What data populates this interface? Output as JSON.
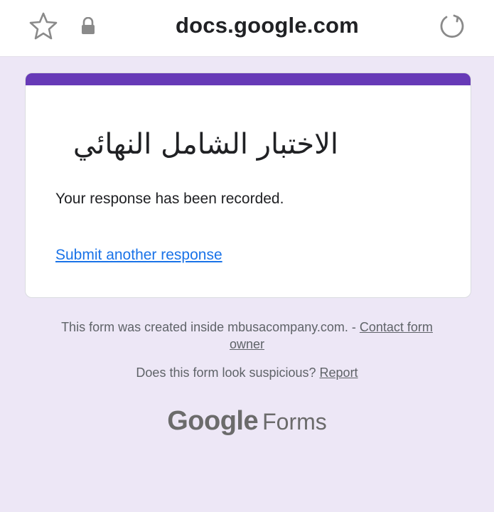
{
  "browser": {
    "url": "docs.google.com",
    "icons": {
      "bookmark": "star-outline-icon",
      "secure": "lock-icon",
      "reload": "reload-icon"
    }
  },
  "form": {
    "title": "الاختبار الشامل النهائي",
    "message": "Your response has been recorded.",
    "submit_another": "Submit another response",
    "accent_color": "#673ab7"
  },
  "footer": {
    "created_prefix": "This form was created inside mbusacompany.com. - ",
    "contact_owner": "Contact form owner",
    "suspicious_prefix": "Does this form look suspicious? ",
    "report": "Report",
    "brand_google": "Google",
    "brand_forms": "Forms"
  },
  "colors": {
    "page_background": "#ede7f6",
    "link_blue": "#1a73e8"
  }
}
